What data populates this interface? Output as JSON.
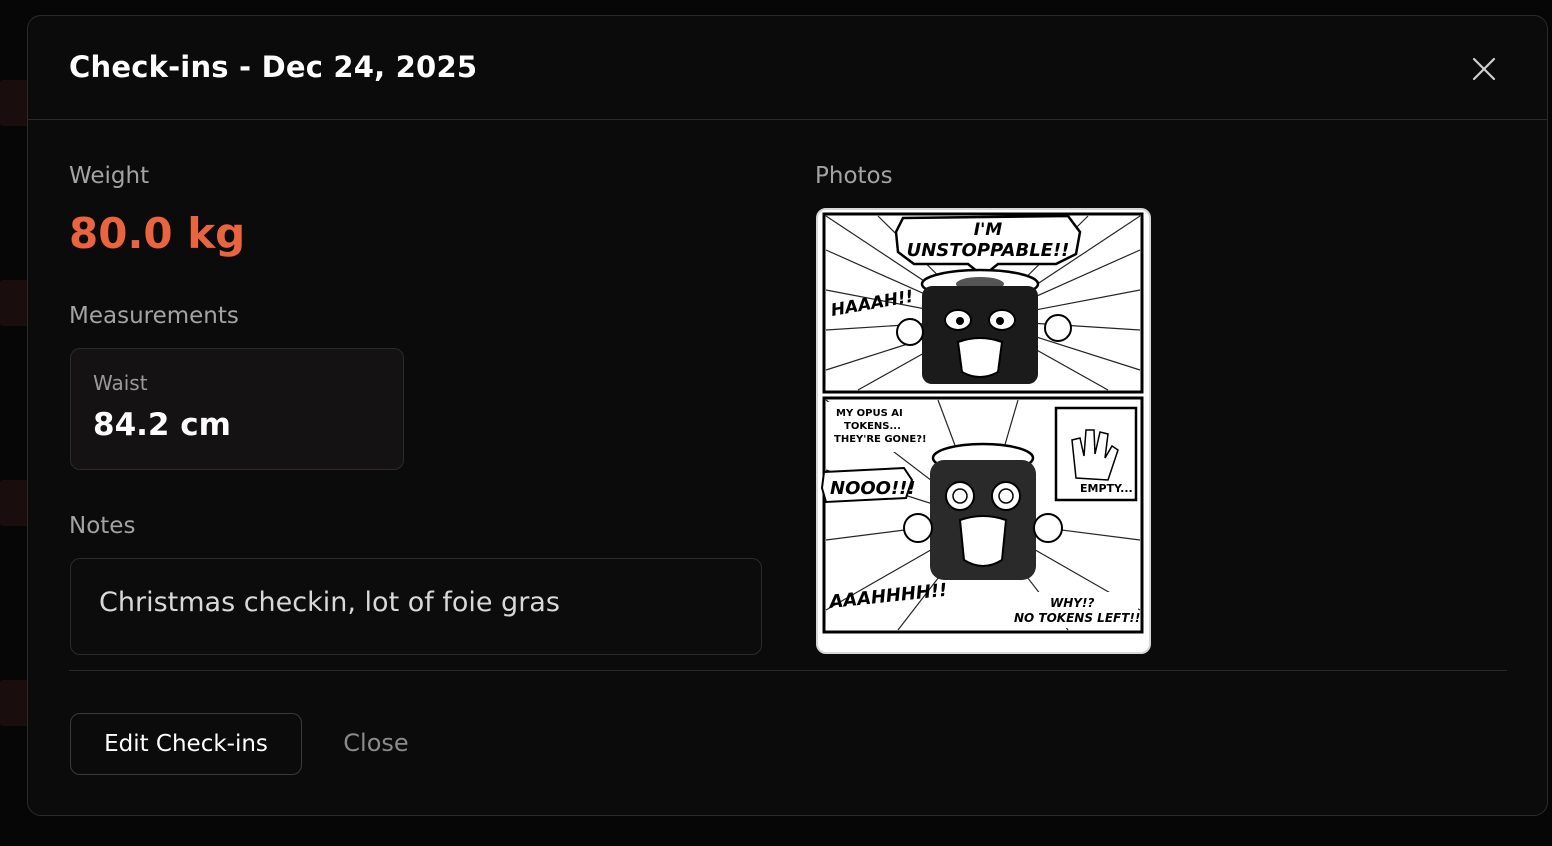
{
  "modal": {
    "title": "Check-ins - Dec 24, 2025"
  },
  "weight": {
    "label": "Weight",
    "value": "80.0 kg",
    "color": "#e8653f"
  },
  "measurements": {
    "label": "Measurements",
    "items": [
      {
        "label": "Waist",
        "value": "84.2 cm"
      }
    ]
  },
  "notes": {
    "label": "Notes",
    "text": "Christmas checkin, lot of foie gras"
  },
  "photos": {
    "label": "Photos",
    "comic_text": {
      "panel1_title_line1": "I'M",
      "panel1_title_line2": "UNSTOPPABLE!!",
      "panel1_shout": "HAAAH!!",
      "panel2_thought_line1": "MY OPUS AI",
      "panel2_thought_line2": "TOKENS...",
      "panel2_thought_line3": "THEY'RE GONE?!",
      "panel2_shout": "NOOO!!!",
      "panel2_inset": "EMPTY...",
      "panel2_scream": "AAAHHHH!!",
      "panel2_caption_line1": "WHY!?",
      "panel2_caption_line2": "NO TOKENS LEFT!!"
    }
  },
  "footer": {
    "edit_label": "Edit Check-ins",
    "close_label": "Close"
  },
  "icons": {
    "close": "close-icon"
  }
}
